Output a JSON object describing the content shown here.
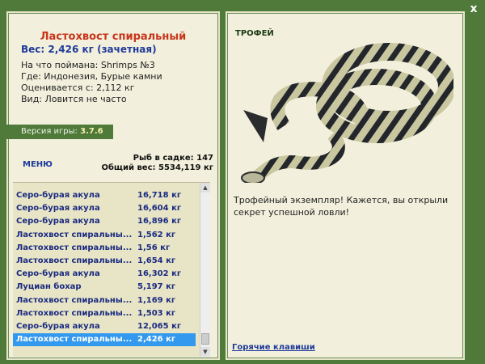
{
  "window": {
    "close_label": "x"
  },
  "fish": {
    "name": "Ластохвост спиральный",
    "weight": "Вес: 2,426 кг (зачетная)",
    "bait": "На что поймана: Shrimps №3",
    "location": "Где: Индонезия, Бурые камни",
    "value": "Оценивается с: 2,112 кг",
    "kind": "Вид: Ловится не часто"
  },
  "version": {
    "label": "Версия игры:",
    "value": "3.7.6"
  },
  "menu": {
    "label": "МЕНЮ"
  },
  "stats": {
    "fish_count": "Рыб в садке: 147",
    "total_weight": "Общий вес: 5534,119 кг"
  },
  "catch_list": [
    {
      "name": "Серо-бурая акула",
      "weight": "16,718 кг"
    },
    {
      "name": "Серо-бурая акула",
      "weight": "16,604 кг"
    },
    {
      "name": "Серо-бурая акула",
      "weight": "16,896 кг"
    },
    {
      "name": "Ластохвост спиральны...",
      "weight": "1,562 кг"
    },
    {
      "name": "Ластохвост спиральны...",
      "weight": "1,56 кг"
    },
    {
      "name": "Ластохвост спиральны...",
      "weight": "1,654 кг"
    },
    {
      "name": "Серо-бурая акула",
      "weight": "16,302 кг"
    },
    {
      "name": "Луциан бохар",
      "weight": "5,197 кг"
    },
    {
      "name": "Ластохвост спиральны...",
      "weight": "1,169 кг"
    },
    {
      "name": "Ластохвост спиральны...",
      "weight": "1,503 кг"
    },
    {
      "name": "Серо-бурая акула",
      "weight": "12,065 кг"
    },
    {
      "name": "Ластохвост спиральны...",
      "weight": "2,426 кг",
      "selected": true
    }
  ],
  "trophy": {
    "label": "ТРОФЕЙ",
    "message": "Трофейный экземпляр! Кажется, вы открыли секрет успешной ловли!"
  },
  "hotkeys": {
    "label": "Горячие клавиши"
  },
  "colors": {
    "frame": "#4f7a3a",
    "panel": "#f2f0dc",
    "title_red": "#c8351b",
    "link_blue": "#1f3a9a",
    "selection": "#3399ee"
  }
}
